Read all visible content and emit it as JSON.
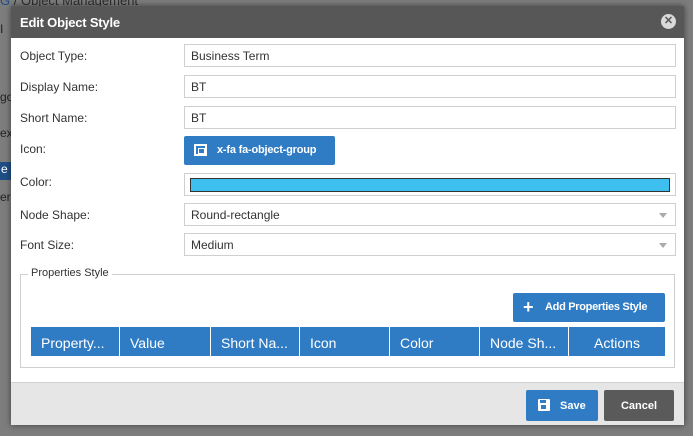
{
  "background": {
    "breadcrumb_home": "G",
    "breadcrumb": "/ Object Management",
    "fragments": [
      "I",
      "go",
      "ex",
      "e",
      "er"
    ]
  },
  "modal": {
    "title": "Edit Object Style",
    "close_icon": "close-circle-icon",
    "fields": {
      "object_type": {
        "label": "Object Type:",
        "value": "Business Term"
      },
      "display_name": {
        "label": "Display Name:",
        "value": "BT"
      },
      "short_name": {
        "label": "Short Name:",
        "value": "BT"
      },
      "icon": {
        "label": "Icon:",
        "button_label": "x-fa fa-object-group",
        "icon": "object-group-icon"
      },
      "color": {
        "label": "Color:",
        "value": "#3dbfef"
      },
      "node_shape": {
        "label": "Node Shape:",
        "value": "Round-rectangle"
      },
      "font_size": {
        "label": "Font Size:",
        "value": "Medium"
      }
    },
    "properties_style": {
      "legend": "Properties Style",
      "add_button": "Add Properties Style",
      "columns": [
        "Property...",
        "Value",
        "Short Na...",
        "Icon",
        "Color",
        "Node Sh...",
        "Actions"
      ]
    },
    "footer": {
      "save_label": "Save",
      "cancel_label": "Cancel"
    }
  },
  "colors": {
    "header": "#575757",
    "primary": "#2f7cc5",
    "cancel": "#5a5a5a",
    "swatch": "#3dbfef"
  }
}
